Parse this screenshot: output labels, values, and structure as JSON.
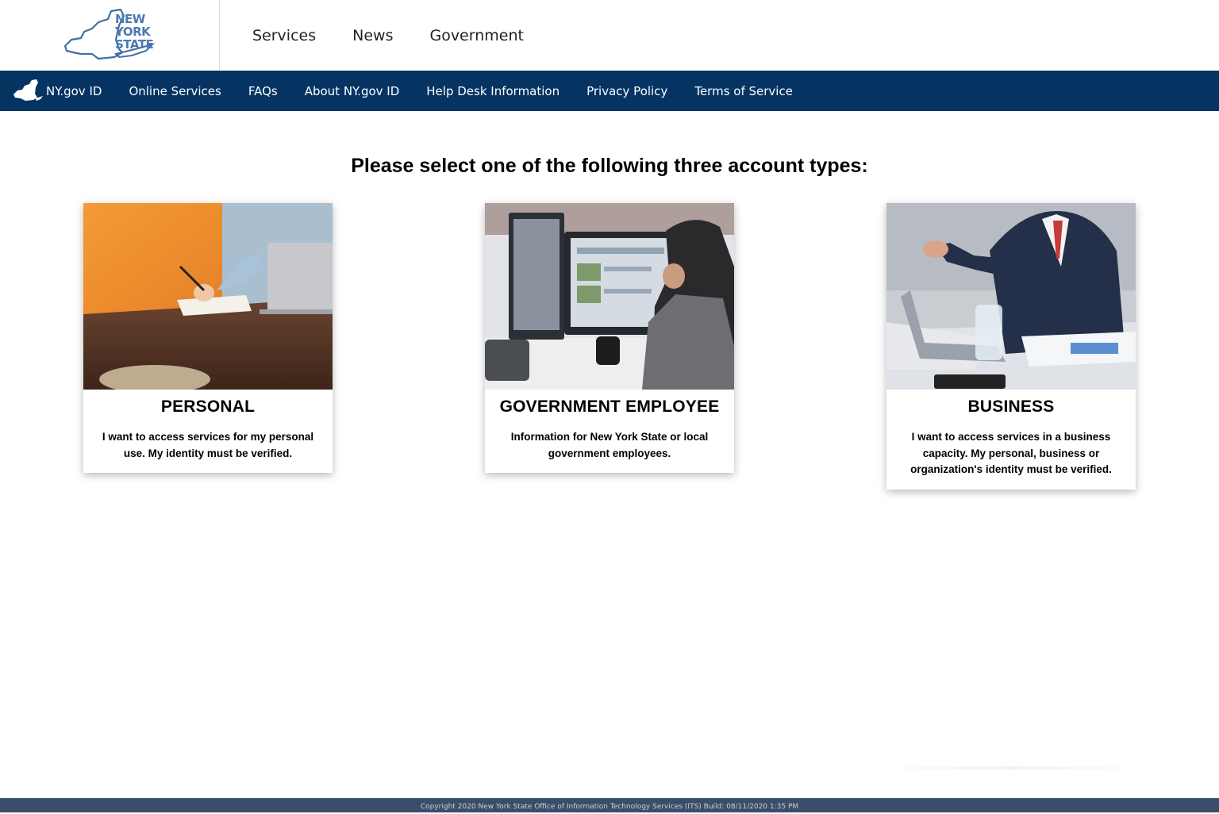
{
  "logo": {
    "line1": "NEW",
    "line2": "YORK",
    "line3": "STATE"
  },
  "top_nav": [
    "Services",
    "News",
    "Government"
  ],
  "blue_nav": [
    "NY.gov ID",
    "Online Services",
    "FAQs",
    "About NY.gov ID",
    "Help Desk Information",
    "Privacy Policy",
    "Terms of Service"
  ],
  "heading": "Please select one of the following three account types:",
  "cards": [
    {
      "title": "PERSONAL",
      "description": "I want to access services for my personal use. My identity must be verified."
    },
    {
      "title": "GOVERNMENT EMPLOYEE",
      "description": "Information for New York State or local government employees."
    },
    {
      "title": "BUSINESS",
      "description": "I want to access services in a business capacity. My personal, business or organization's identity must be verified."
    }
  ],
  "footer": {
    "text": "Copyright 2020 New York State Office of Information Technology Services (ITS) Build: 08/11/2020 1:35 PM"
  },
  "colors": {
    "nav_bar": "#053463",
    "footer": "#3b4d6a",
    "logo": "#4b7ab0"
  }
}
